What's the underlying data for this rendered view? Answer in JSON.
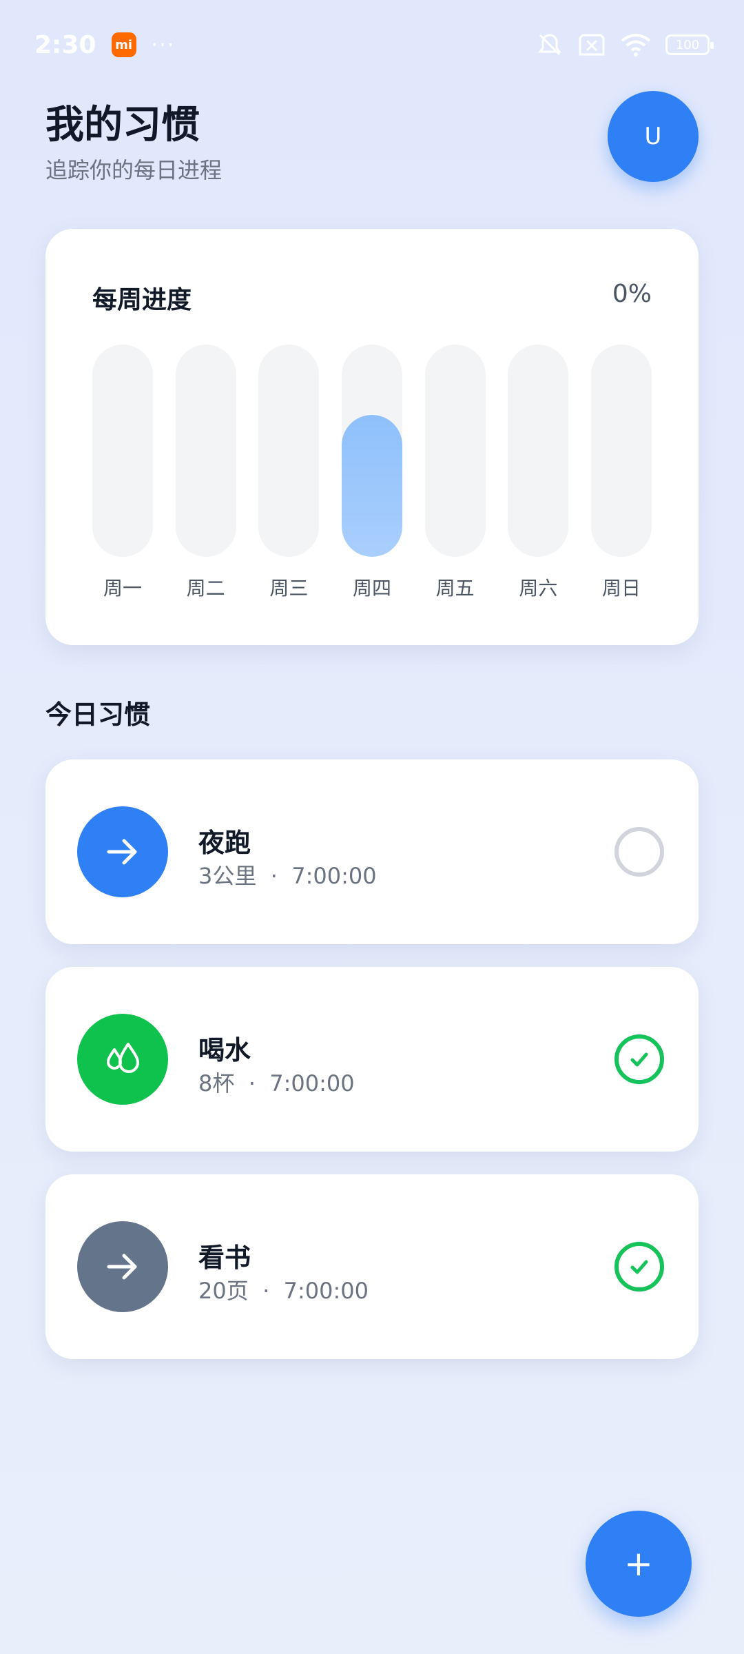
{
  "status_bar": {
    "time": "2:30",
    "mi_logo": "mi",
    "more": "···",
    "battery": "100",
    "icons": [
      "mute-icon",
      "no-sim-icon",
      "wifi-icon",
      "battery-icon"
    ]
  },
  "header": {
    "title": "我的习惯",
    "subtitle": "追踪你的每日进程",
    "avatar_initial": "U"
  },
  "weekly": {
    "title": "每周进度",
    "percent": "0%",
    "days": [
      {
        "label": "周一",
        "progress": 0
      },
      {
        "label": "周二",
        "progress": 0
      },
      {
        "label": "周三",
        "progress": 0
      },
      {
        "label": "周四",
        "progress": 0.67
      },
      {
        "label": "周五",
        "progress": 0
      },
      {
        "label": "周六",
        "progress": 0
      },
      {
        "label": "周日",
        "progress": 0
      }
    ]
  },
  "today": {
    "title": "今日习惯",
    "habits": [
      {
        "name": "夜跑",
        "amount": "3公里",
        "sep": "·",
        "time": "7:00:00",
        "icon": "arrow-right-icon",
        "color": "#2f7ff5",
        "done": false
      },
      {
        "name": "喝水",
        "amount": "8杯",
        "sep": "·",
        "time": "7:00:00",
        "icon": "water-drops-icon",
        "color": "#0fc14d",
        "done": true
      },
      {
        "name": "看书",
        "amount": "20页",
        "sep": "·",
        "time": "7:00:00",
        "icon": "arrow-right-icon",
        "color": "#64748b",
        "done": true
      }
    ]
  },
  "fab": {
    "label": "+"
  },
  "colors": {
    "accent": "#2f7ff5",
    "success": "#16c25a",
    "bar_fill": "#a9cffd"
  }
}
